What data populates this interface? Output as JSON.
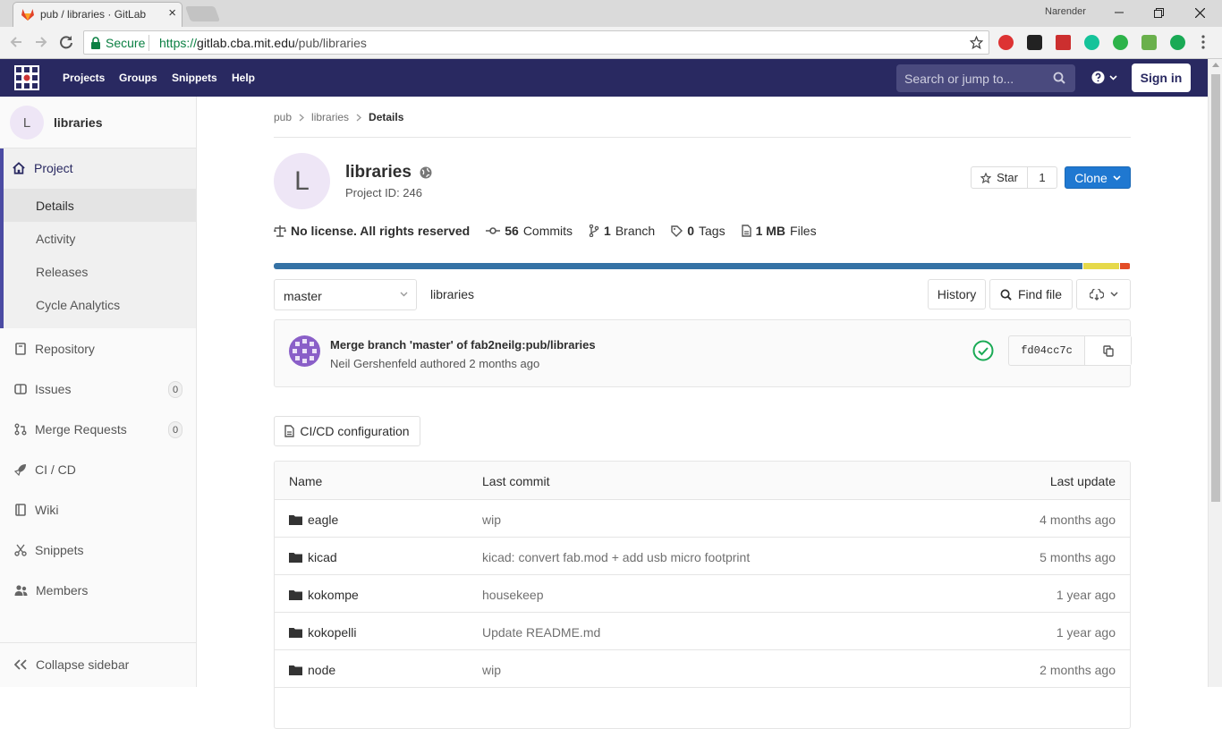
{
  "browser": {
    "tab_title": "pub / libraries · GitLab",
    "profile_name": "Narender",
    "secure_label": "Secure",
    "url_scheme": "https://",
    "url_host": "gitlab.cba.mit.edu",
    "url_path": "/pub/libraries"
  },
  "header": {
    "nav": [
      "Projects",
      "Groups",
      "Snippets",
      "Help"
    ],
    "search_placeholder": "Search or jump to...",
    "sign_in": "Sign in"
  },
  "sidebar": {
    "avatar_letter": "L",
    "project_name": "libraries",
    "section_label": "Project",
    "sub_items": [
      "Details",
      "Activity",
      "Releases",
      "Cycle Analytics"
    ],
    "items": [
      {
        "label": "Repository",
        "icon": "book-icon"
      },
      {
        "label": "Issues",
        "icon": "issues-icon",
        "count": "0"
      },
      {
        "label": "Merge Requests",
        "icon": "merge-request-icon",
        "count": "0"
      },
      {
        "label": "CI / CD",
        "icon": "rocket-icon"
      },
      {
        "label": "Wiki",
        "icon": "wiki-icon"
      },
      {
        "label": "Snippets",
        "icon": "scissors-icon"
      },
      {
        "label": "Members",
        "icon": "users-icon"
      }
    ],
    "collapse_label": "Collapse sidebar"
  },
  "breadcrumb": [
    "pub",
    "libraries",
    "Details"
  ],
  "project": {
    "avatar_letter": "L",
    "title": "libraries",
    "id_label": "Project ID: 246",
    "star_label": "Star",
    "star_count": "1",
    "clone_label": "Clone"
  },
  "stats": {
    "license": "No license. All rights reserved",
    "commits_count": "56",
    "commits_label": "Commits",
    "branch_count": "1",
    "branch_label": "Branch",
    "tags_count": "0",
    "tags_label": "Tags",
    "files_size": "1 MB",
    "files_label": "Files"
  },
  "languages": [
    {
      "share": 94.7,
      "color": "#3572a5"
    },
    {
      "share": 4.1,
      "color": "#e6d94a"
    },
    {
      "share": 1.2,
      "color": "#e34c26"
    }
  ],
  "toolbar": {
    "branch": "master",
    "path": "libraries",
    "history": "History",
    "find_file": "Find file"
  },
  "last_commit": {
    "message": "Merge branch 'master' of fab2neilg:pub/libraries",
    "author": "Neil Gershenfeld",
    "authored_text": "authored",
    "time": "2 months ago",
    "sha": "fd04cc7c",
    "status_color": "#1aaa55"
  },
  "cicd_button": "CI/CD configuration",
  "file_table": {
    "headers": [
      "Name",
      "Last commit",
      "Last update"
    ],
    "rows": [
      {
        "name": "eagle",
        "commit": "wip",
        "updated": "4 months ago"
      },
      {
        "name": "kicad",
        "commit": "kicad: convert fab.mod + add usb micro footprint",
        "updated": "5 months ago"
      },
      {
        "name": "kokompe",
        "commit": "housekeep",
        "updated": "1 year ago"
      },
      {
        "name": "kokopelli",
        "commit": "Update README.md",
        "updated": "1 year ago"
      },
      {
        "name": "node",
        "commit": "wip",
        "updated": "2 months ago"
      }
    ]
  },
  "colors": {
    "header_bg": "#292961",
    "accent": "#4b4ba3",
    "clone_blue": "#1f78d1"
  }
}
